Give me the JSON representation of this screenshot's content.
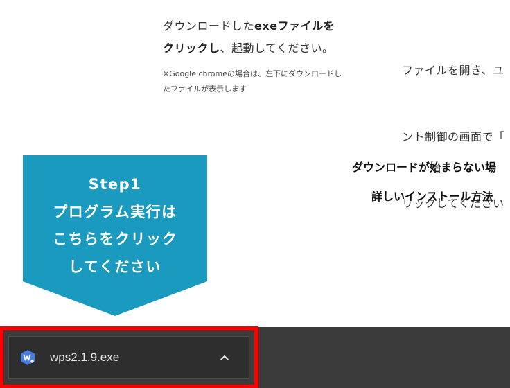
{
  "column_left": {
    "line1_plain": "ダウンロードした",
    "line1_bold": "exeファイルを",
    "line2_bold": "クリックし",
    "line2_plain": "、起動してください。",
    "note_line1": "※Google chromeの場合は、左下にダウンロードし",
    "note_line2": "たファイルが表示します"
  },
  "column_right": {
    "line1": "ファイルを開き、ユ",
    "line2": "ント制御の画面で「",
    "line3": "リックしてください"
  },
  "right_links": {
    "line1": "ダウンロードが始まらない場",
    "line2": "詳しいインストール方法"
  },
  "step_banner": {
    "line1": "Step1",
    "line2": "プログラム実行は",
    "line3": "こちらをクリック",
    "line4": "してください",
    "color": "#1a9abf"
  },
  "download_bar": {
    "file_name": "wps2.1.9.exe",
    "file_icon": "wps-office-icon",
    "expand_icon": "chevron-up-icon",
    "highlight_color": "#ff0000"
  }
}
